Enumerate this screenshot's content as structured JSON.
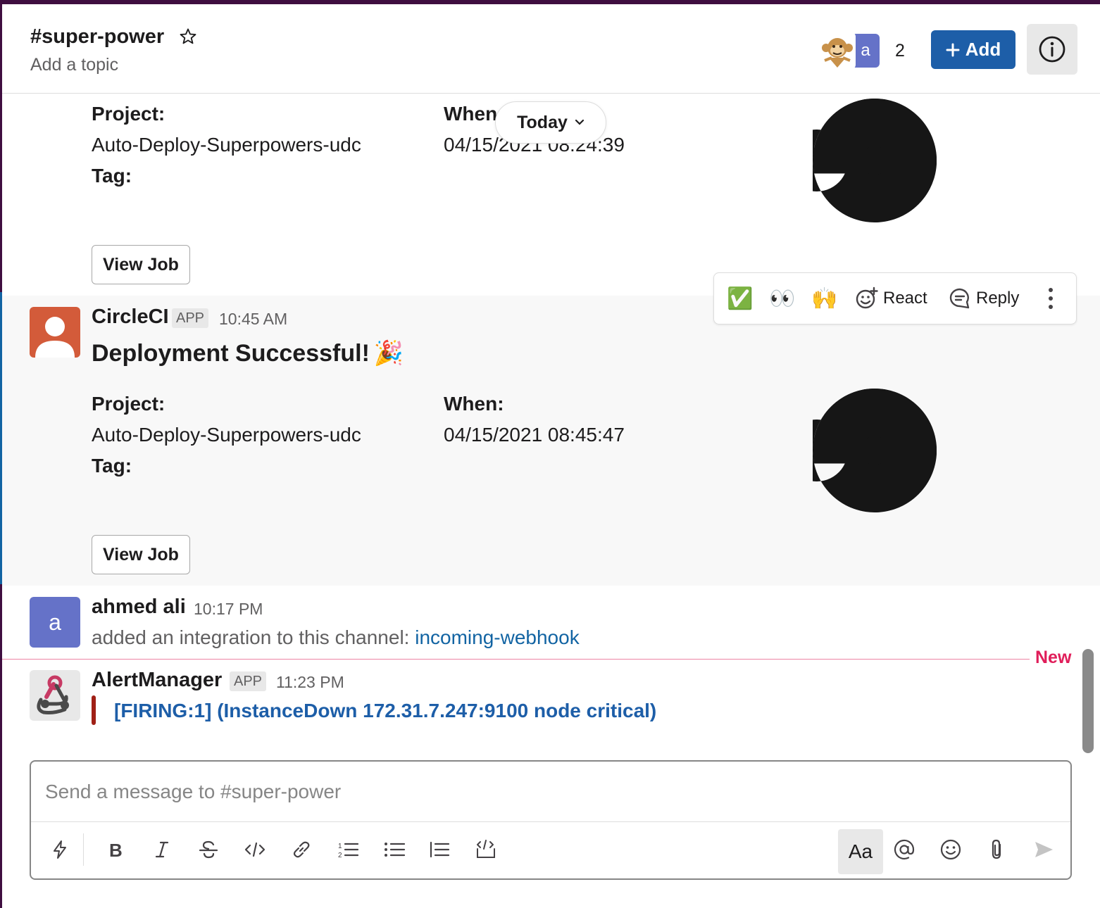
{
  "header": {
    "channel": "#super-power",
    "topic": "Add a topic",
    "member_count": "2",
    "member_initial": "a",
    "add_label": "Add"
  },
  "date_divider": {
    "label": "Today"
  },
  "messages": {
    "prev": {
      "project_label": "Project:",
      "project": "Auto-Deploy-Superpowers-udc",
      "tag_label": "Tag:",
      "when_label": "When:",
      "when": "04/15/2021 08:24:39",
      "button": "View Job"
    },
    "circleci": {
      "sender": "CircleCI",
      "badge": "APP",
      "time": "10:45 AM",
      "title": "Deployment Successful!",
      "title_emoji": "🎉",
      "project_label": "Project:",
      "project": "Auto-Deploy-Superpowers-udc",
      "tag_label": "Tag:",
      "when_label": "When:",
      "when": "04/15/2021 08:45:47",
      "button": "View Job"
    },
    "ahmed": {
      "sender": "ahmed ali",
      "initial": "a",
      "time": "10:17 PM",
      "text": "added an integration to this channel: ",
      "link": "incoming-webhook"
    },
    "new_label": "New",
    "alert": {
      "sender": "AlertManager",
      "badge": "APP",
      "time": "11:23 PM",
      "text": "[FIRING:1]  (InstanceDown 172.31.7.247:9100 node critical)"
    }
  },
  "actions": {
    "emoji1": "✅",
    "emoji2": "👀",
    "emoji3": "🙌",
    "react": "React",
    "reply": "Reply"
  },
  "composer": {
    "placeholder": "Send a message to #super-power",
    "format_label": "Aa"
  },
  "colors": {
    "sidebar": "#3f0e40",
    "accent_blue": "#1d5ea8",
    "link": "#1264a3",
    "new_red": "#e01e5a",
    "alert_bar": "#a02016",
    "circleci_avatar": "#d35b3a",
    "ahmed_avatar": "#6572c8"
  }
}
